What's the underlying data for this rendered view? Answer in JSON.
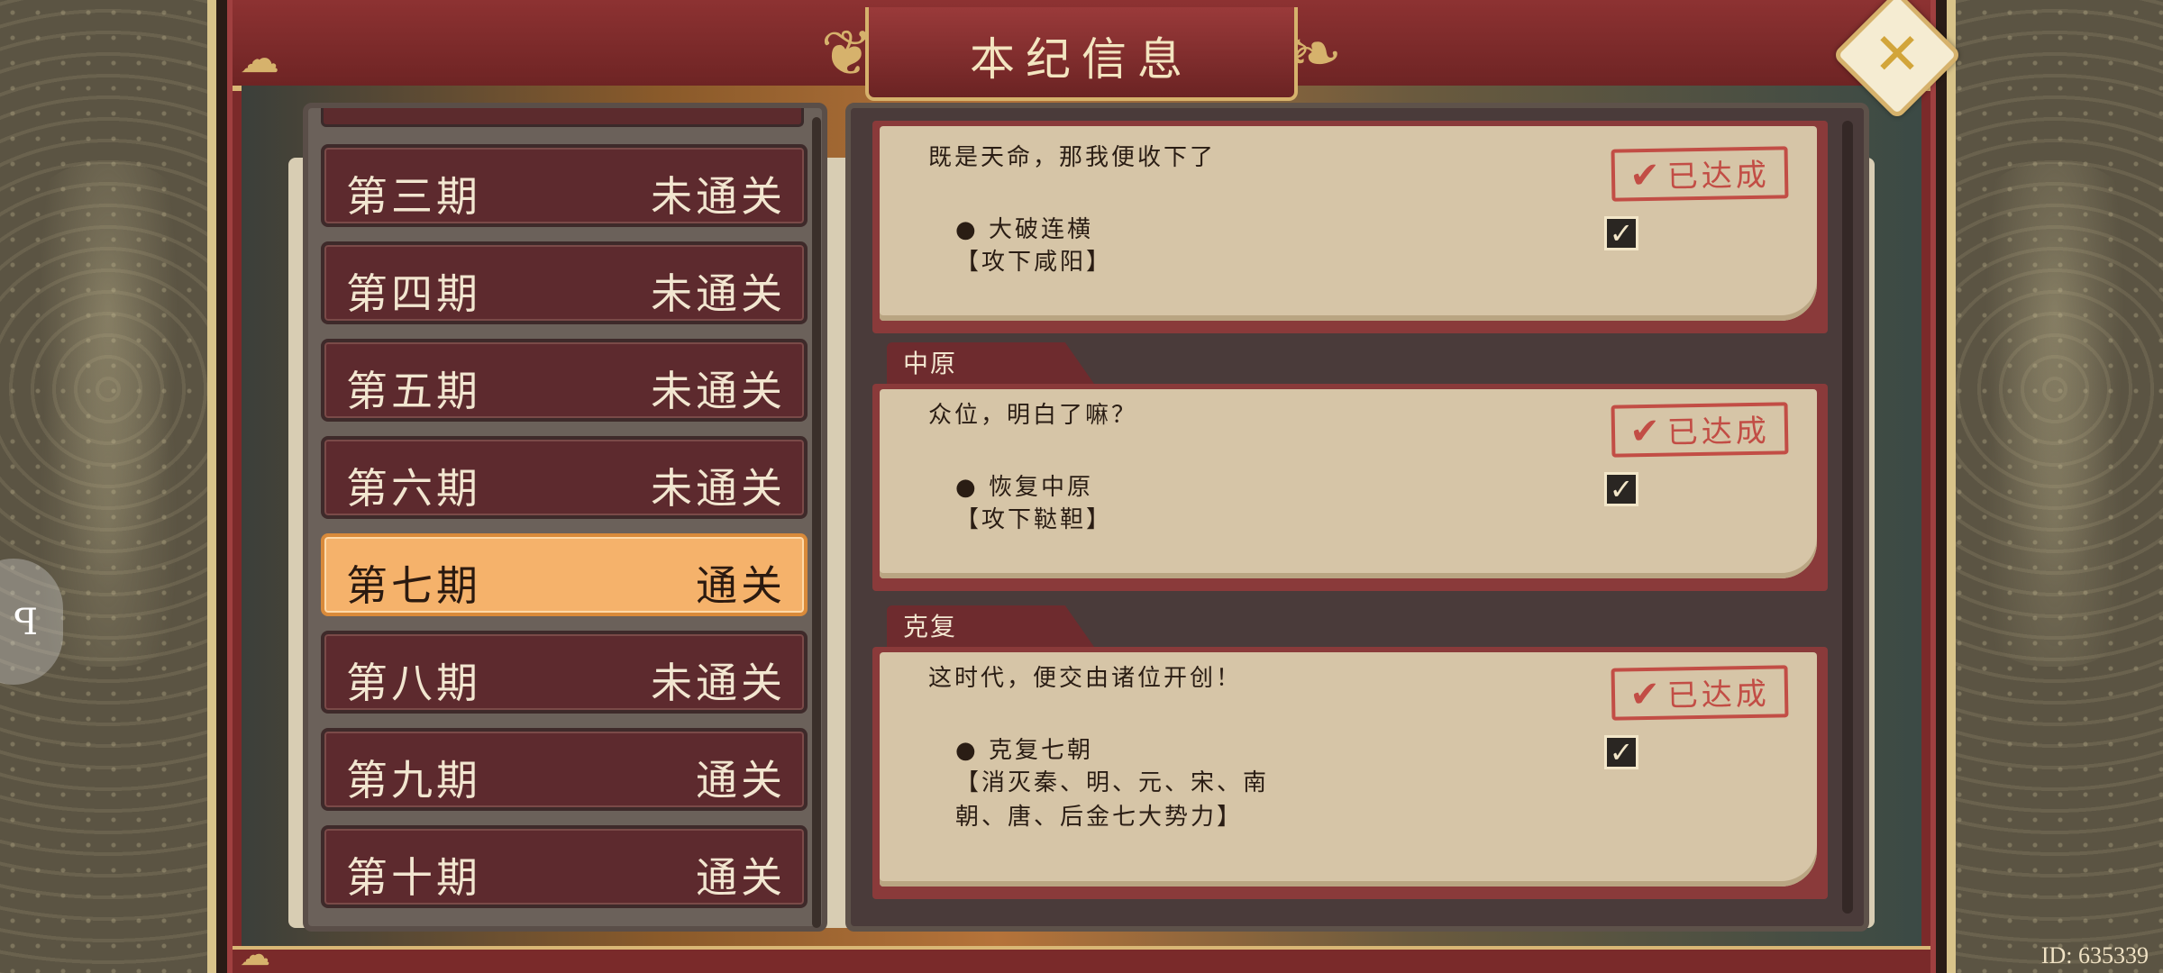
{
  "header": {
    "title": "本纪信息",
    "close_icon": "close-x-icon"
  },
  "periods": [
    {
      "name": "第三期",
      "status": "未通关",
      "active": false
    },
    {
      "name": "第四期",
      "status": "未通关",
      "active": false
    },
    {
      "name": "第五期",
      "status": "未通关",
      "active": false
    },
    {
      "name": "第六期",
      "status": "未通关",
      "active": false
    },
    {
      "name": "第七期",
      "status": "通关",
      "active": true
    },
    {
      "name": "第八期",
      "status": "未通关",
      "active": false
    },
    {
      "name": "第九期",
      "status": "通关",
      "active": false
    },
    {
      "name": "第十期",
      "status": "通关",
      "active": false
    }
  ],
  "achievements": [
    {
      "region": "",
      "quote": "既是天命，那我便收下了",
      "goal": "● 大破连横",
      "desc": "【攻下咸阳】",
      "stamp": "已达成",
      "checked": true
    },
    {
      "region": "中原",
      "quote": "众位，明白了嘛？",
      "goal": "● 恢复中原",
      "desc": "【攻下鞑靼】",
      "stamp": "已达成",
      "checked": true
    },
    {
      "region": "克复",
      "quote": "这时代，便交由诸位开创！",
      "goal": "● 克复七朝",
      "desc": "【消灭秦、明、元、宋、南朝、唐、后金七大势力】",
      "stamp": "已达成",
      "checked": true
    }
  ],
  "footer": {
    "id_label": "ID: 635339"
  },
  "colors": {
    "active_period": "#f5b26b",
    "period_bg": "#5d2a2e",
    "stamp_red": "#c0413b",
    "frame_gold": "#d6b26c"
  }
}
